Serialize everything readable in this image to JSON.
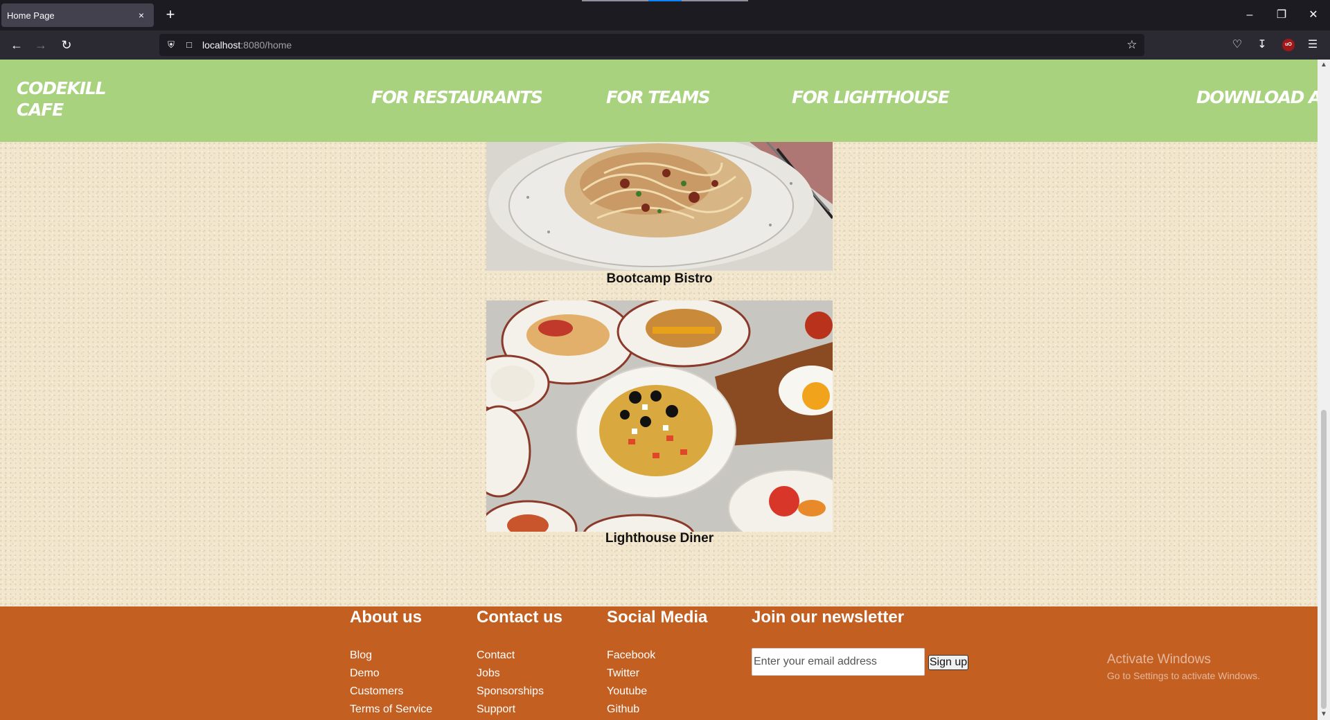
{
  "browser": {
    "tab_title": "Home Page",
    "tab_close_icon": "×",
    "new_tab_icon": "+",
    "url_host": "localhost",
    "url_rest": ":8080/home",
    "ublock_label": "uO"
  },
  "header": {
    "logo": "CODEKILL CAFE",
    "nav": [
      "FOR RESTAURANTS",
      "FOR TEAMS",
      "FOR LIGHTHOUSE",
      "DOWNLOAD APP"
    ],
    "background": "#a8d27e"
  },
  "restaurants": [
    {
      "name": "Bootcamp Bistro",
      "image": "pasta-dish"
    },
    {
      "name": "Lighthouse Diner",
      "image": "diner-platters"
    }
  ],
  "footer": {
    "background": "#c45f22",
    "about": {
      "heading": "About us",
      "links": [
        "Blog",
        "Demo",
        "Customers",
        "Terms of Service"
      ]
    },
    "contact": {
      "heading": "Contact us",
      "links": [
        "Contact",
        "Jobs",
        "Sponsorships",
        "Support"
      ]
    },
    "social": {
      "heading": "Social Media",
      "links": [
        "Facebook",
        "Twitter",
        "Youtube",
        "Github"
      ]
    },
    "newsletter": {
      "heading": "Join our newsletter",
      "placeholder": "Enter your email address",
      "button": "Sign up"
    }
  },
  "watermark": {
    "line1": "Activate Windows",
    "line2": "Go to Settings to activate Windows."
  }
}
